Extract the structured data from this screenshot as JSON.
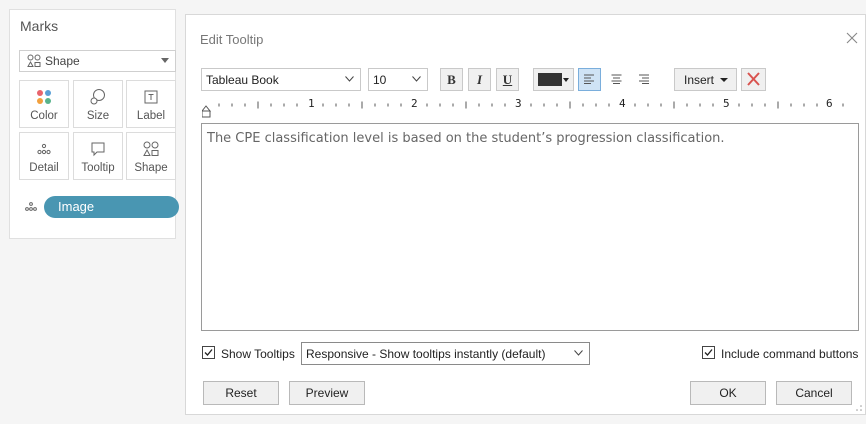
{
  "marks": {
    "title": "Marks",
    "mark_type": {
      "label": "Shape",
      "icon": "shape-icon"
    },
    "tiles": [
      {
        "label": "Color",
        "icon": "color-icon"
      },
      {
        "label": "Size",
        "icon": "size-icon"
      },
      {
        "label": "Label",
        "icon": "label-icon"
      },
      {
        "label": "Detail",
        "icon": "detail-icon"
      },
      {
        "label": "Tooltip",
        "icon": "tooltip-icon"
      },
      {
        "label": "Shape",
        "icon": "shape-icon"
      }
    ],
    "field_pill": {
      "label": "Image",
      "icon": "detail-icon",
      "color": "#4996b2"
    }
  },
  "dialog": {
    "title": "Edit Tooltip",
    "toolbar": {
      "font_family": "Tableau Book",
      "font_size": "10",
      "bold": "B",
      "italic": "I",
      "underline": "U",
      "text_color": "#333333",
      "align_selected": "left",
      "insert_label": "Insert"
    },
    "ruler_numbers": [
      "1",
      "2",
      "3",
      "4",
      "5",
      "6"
    ],
    "editor_text": "The CPE classification level is based on the student’s progression classification.",
    "show_tooltips": {
      "label": "Show Tooltips",
      "checked": true
    },
    "tooltip_mode": "Responsive - Show tooltips instantly (default)",
    "include_command_buttons": {
      "label": "Include command buttons",
      "checked": true
    },
    "buttons": {
      "reset": "Reset",
      "preview": "Preview",
      "ok": "OK",
      "cancel": "Cancel"
    },
    "accent_colors": {
      "clear_x": "#d9534f",
      "selected": "#cfe3f5"
    }
  }
}
